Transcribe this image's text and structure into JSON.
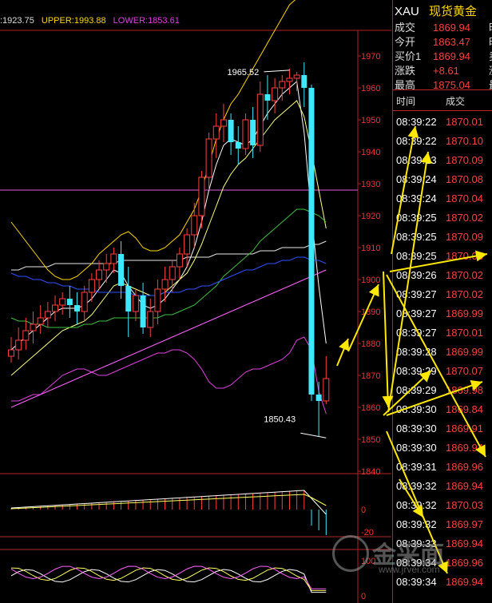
{
  "header": {
    "mid_label": ":1923.75",
    "upper_label": "UPPER:1993.88",
    "lower_label": "LOWER:1853.61"
  },
  "quote_panel": {
    "symbol": "XAU",
    "name": "现货黄金",
    "rows": [
      {
        "label": "成交",
        "value": "1869.94",
        "tail": "时"
      },
      {
        "label": "今开",
        "value": "1863.47",
        "tail": "时"
      },
      {
        "label": "买价1",
        "value": "1869.94",
        "tail": "卖"
      },
      {
        "label": "涨跌",
        "value": "+8.61",
        "tail": "涨"
      },
      {
        "label": "最高",
        "value": "1875.04",
        "tail": "最"
      }
    ],
    "col_time": "时间",
    "col_price": "成交",
    "ticks": [
      {
        "time": "08:39:22",
        "price": "1870.01"
      },
      {
        "time": "08:39:22",
        "price": "1870.10"
      },
      {
        "time": "08:39:23",
        "price": "1870.09"
      },
      {
        "time": "08:39:24",
        "price": "1870.08"
      },
      {
        "time": "08:39:24",
        "price": "1870.04"
      },
      {
        "time": "08:39:25",
        "price": "1870.02"
      },
      {
        "time": "08:39:25",
        "price": "1870.09"
      },
      {
        "time": "08:39:25",
        "price": "1870.03"
      },
      {
        "time": "08:39:26",
        "price": "1870.02"
      },
      {
        "time": "08:39:27",
        "price": "1870.02"
      },
      {
        "time": "08:39:27",
        "price": "1869.99"
      },
      {
        "time": "08:39:27",
        "price": "1870.01"
      },
      {
        "time": "08:39:28",
        "price": "1869.99"
      },
      {
        "time": "08:39:29",
        "price": "1870.07"
      },
      {
        "time": "08:39:29",
        "price": "1869.98"
      },
      {
        "time": "08:39:30",
        "price": "1869.84"
      },
      {
        "time": "08:39:30",
        "price": "1869.91"
      },
      {
        "time": "08:39:30",
        "price": "1869.94"
      },
      {
        "time": "08:39:31",
        "price": "1869.96"
      },
      {
        "time": "08:39:32",
        "price": "1869.94"
      },
      {
        "time": "08:39:32",
        "price": "1870.03"
      },
      {
        "time": "08:39:32",
        "price": "1869.97"
      },
      {
        "time": "08:39:33",
        "price": "1869.94"
      },
      {
        "time": "08:39:34",
        "price": "1869.96"
      },
      {
        "time": "08:39:34",
        "price": "1869.94"
      }
    ]
  },
  "watermark": {
    "cn": "金采面",
    "url": "www.jrvei.com"
  },
  "colors": {
    "up": "#ff4040",
    "down": "#40e8ff",
    "axis": "#b22222",
    "mid_band": "#e6e6e6",
    "upper_band": "#ffd700",
    "lower_band": "#e040e0",
    "arrow": "#ffe800"
  },
  "chart_data": {
    "type": "candlestick",
    "y_axis": {
      "min": 1840,
      "max": 1975,
      "ticks": [
        1840,
        1850,
        1860,
        1870,
        1880,
        1890,
        1900,
        1910,
        1920,
        1930,
        1940,
        1950,
        1960,
        1970
      ]
    },
    "annotations": [
      {
        "text": "1965.52",
        "value": 1965.52,
        "index": 38
      },
      {
        "text": "1850.43",
        "value": 1850.43,
        "index": 43
      }
    ],
    "candles": [
      {
        "o": 1876,
        "h": 1882,
        "c": 1878,
        "l": 1874
      },
      {
        "o": 1878,
        "h": 1885,
        "c": 1881,
        "l": 1875
      },
      {
        "o": 1881,
        "h": 1888,
        "c": 1884,
        "l": 1878
      },
      {
        "o": 1884,
        "h": 1890,
        "c": 1886,
        "l": 1880
      },
      {
        "o": 1886,
        "h": 1892,
        "c": 1888,
        "l": 1883
      },
      {
        "o": 1888,
        "h": 1893,
        "c": 1890,
        "l": 1885
      },
      {
        "o": 1890,
        "h": 1895,
        "c": 1892,
        "l": 1887
      },
      {
        "o": 1892,
        "h": 1896,
        "c": 1894,
        "l": 1889
      },
      {
        "o": 1894,
        "h": 1898,
        "c": 1892,
        "l": 1888
      },
      {
        "o": 1892,
        "h": 1896,
        "c": 1890,
        "l": 1886
      },
      {
        "o": 1890,
        "h": 1898,
        "c": 1896,
        "l": 1887
      },
      {
        "o": 1896,
        "h": 1902,
        "c": 1900,
        "l": 1893
      },
      {
        "o": 1900,
        "h": 1906,
        "c": 1903,
        "l": 1897
      },
      {
        "o": 1903,
        "h": 1908,
        "c": 1905,
        "l": 1899
      },
      {
        "o": 1905,
        "h": 1910,
        "c": 1908,
        "l": 1902
      },
      {
        "o": 1908,
        "h": 1912,
        "c": 1898,
        "l": 1894
      },
      {
        "o": 1898,
        "h": 1904,
        "c": 1890,
        "l": 1882
      },
      {
        "o": 1890,
        "h": 1897,
        "c": 1895,
        "l": 1887
      },
      {
        "o": 1895,
        "h": 1899,
        "c": 1885,
        "l": 1883
      },
      {
        "o": 1885,
        "h": 1894,
        "c": 1890,
        "l": 1882
      },
      {
        "o": 1890,
        "h": 1900,
        "c": 1897,
        "l": 1886
      },
      {
        "o": 1897,
        "h": 1904,
        "c": 1900,
        "l": 1893
      },
      {
        "o": 1900,
        "h": 1906,
        "c": 1904,
        "l": 1896
      },
      {
        "o": 1904,
        "h": 1910,
        "c": 1908,
        "l": 1900
      },
      {
        "o": 1908,
        "h": 1916,
        "c": 1914,
        "l": 1904
      },
      {
        "o": 1914,
        "h": 1924,
        "c": 1920,
        "l": 1910
      },
      {
        "o": 1920,
        "h": 1934,
        "c": 1932,
        "l": 1916
      },
      {
        "o": 1932,
        "h": 1946,
        "c": 1944,
        "l": 1928
      },
      {
        "o": 1944,
        "h": 1952,
        "c": 1948,
        "l": 1938
      },
      {
        "o": 1948,
        "h": 1955,
        "c": 1950,
        "l": 1943
      },
      {
        "o": 1950,
        "h": 1952,
        "c": 1943,
        "l": 1939
      },
      {
        "o": 1943,
        "h": 1948,
        "c": 1941,
        "l": 1936
      },
      {
        "o": 1941,
        "h": 1952,
        "c": 1950,
        "l": 1939
      },
      {
        "o": 1950,
        "h": 1954,
        "c": 1942,
        "l": 1938
      },
      {
        "o": 1942,
        "h": 1962,
        "c": 1958,
        "l": 1940
      },
      {
        "o": 1958,
        "h": 1964,
        "c": 1956,
        "l": 1950
      },
      {
        "o": 1956,
        "h": 1963,
        "c": 1960,
        "l": 1952
      },
      {
        "o": 1960,
        "h": 1964,
        "c": 1962,
        "l": 1956
      },
      {
        "o": 1962,
        "h": 1966,
        "c": 1963,
        "l": 1958
      },
      {
        "o": 1963,
        "h": 1965,
        "c": 1964,
        "l": 1959
      },
      {
        "o": 1964,
        "h": 1968,
        "c": 1960,
        "l": 1954
      },
      {
        "o": 1960,
        "h": 1961,
        "c": 1864,
        "l": 1862
      },
      {
        "o": 1864,
        "h": 1868,
        "c": 1862,
        "l": 1851
      },
      {
        "o": 1862,
        "h": 1876,
        "c": 1869,
        "l": 1861
      }
    ],
    "bands": {
      "mid": [
        1903,
        1903,
        1904,
        1904,
        1904,
        1904,
        1905,
        1905,
        1905,
        1905,
        1905,
        1905,
        1905,
        1905,
        1905,
        1906,
        1906,
        1906,
        1906,
        1906,
        1906,
        1906,
        1906,
        1906,
        1907,
        1907,
        1907,
        1907,
        1908,
        1908,
        1908,
        1908,
        1908,
        1908,
        1909,
        1909,
        1909,
        1910,
        1910,
        1910,
        1910,
        1911,
        1911,
        1912
      ],
      "upper": [
        1918,
        1915,
        1912,
        1909,
        1906,
        1903,
        1901,
        1900,
        1900,
        1901,
        1903,
        1905,
        1908,
        1910,
        1912,
        1914,
        1915,
        1913,
        1910,
        1909,
        1909,
        1910,
        1912,
        1914,
        1918,
        1922,
        1928,
        1936,
        1944,
        1950,
        1955,
        1958,
        1962,
        1966,
        1970,
        1974,
        1978,
        1982,
        1986,
        1988,
        1990,
        1990,
        1990,
        1990
      ],
      "lower": [
        1862,
        1862,
        1863,
        1864,
        1864,
        1866,
        1868,
        1870,
        1871,
        1872,
        1872,
        1871,
        1870,
        1870,
        1871,
        1872,
        1873,
        1874,
        1875,
        1876,
        1877,
        1877,
        1878,
        1878,
        1877,
        1875,
        1872,
        1868,
        1866,
        1866,
        1867,
        1869,
        1871,
        1872,
        1872,
        1873,
        1874,
        1875,
        1877,
        1881,
        1882,
        1878,
        1865,
        1858
      ]
    },
    "ma_lines": [
      {
        "color": "#ffffff",
        "values": [
          1878,
          1880,
          1882,
          1884,
          1886,
          1888,
          1890,
          1891,
          1891,
          1891,
          1892,
          1894,
          1897,
          1900,
          1903,
          1902,
          1898,
          1895,
          1892,
          1891,
          1892,
          1894,
          1897,
          1900,
          1904,
          1910,
          1918,
          1928,
          1936,
          1942,
          1944,
          1943,
          1942,
          1944,
          1948,
          1952,
          1955,
          1958,
          1960,
          1962,
          1946,
          1920,
          1898,
          1880
        ]
      },
      {
        "color": "#ffff80",
        "values": [
          1870,
          1872,
          1874,
          1876,
          1878,
          1880,
          1882,
          1884,
          1885,
          1886,
          1887,
          1889,
          1892,
          1895,
          1898,
          1899,
          1898,
          1897,
          1896,
          1895,
          1895,
          1896,
          1898,
          1900,
          1902,
          1906,
          1911,
          1917,
          1923,
          1929,
          1933,
          1936,
          1938,
          1941,
          1944,
          1947,
          1950,
          1952,
          1954,
          1956,
          1951,
          1940,
          1928,
          1916
        ]
      },
      {
        "color": "#40c040",
        "values": [
          1888,
          1887,
          1887,
          1886,
          1886,
          1885,
          1885,
          1885,
          1885,
          1885,
          1886,
          1886,
          1887,
          1887,
          1888,
          1888,
          1888,
          1888,
          1888,
          1888,
          1888,
          1889,
          1889,
          1890,
          1891,
          1892,
          1894,
          1896,
          1898,
          1901,
          1903,
          1905,
          1907,
          1909,
          1912,
          1914,
          1916,
          1918,
          1920,
          1922,
          1922,
          1921,
          1920,
          1918
        ]
      },
      {
        "color": "#3050ff",
        "values": [
          1902,
          1901,
          1901,
          1900,
          1900,
          1899,
          1899,
          1898,
          1898,
          1897,
          1897,
          1897,
          1896,
          1896,
          1896,
          1896,
          1896,
          1895,
          1895,
          1895,
          1895,
          1896,
          1896,
          1896,
          1897,
          1897,
          1898,
          1898,
          1899,
          1900,
          1901,
          1902,
          1903,
          1903,
          1904,
          1905,
          1905,
          1906,
          1906,
          1907,
          1907,
          1906,
          1906,
          1905
        ]
      },
      {
        "color": "#ff60ff",
        "values": [
          1860,
          1861,
          1862,
          1863,
          1864,
          1865,
          1866,
          1867,
          1868,
          1869,
          1870,
          1871,
          1872,
          1873,
          1874,
          1875,
          1876,
          1877,
          1878,
          1879,
          1880,
          1881,
          1882,
          1883,
          1884,
          1885,
          1886,
          1887,
          1888,
          1889,
          1890,
          1891,
          1892,
          1893,
          1894,
          1895,
          1896,
          1897,
          1898,
          1899,
          1900,
          1901,
          1902,
          1903
        ]
      }
    ],
    "horizontal_line": {
      "value": 1928,
      "color": "#e060e0"
    },
    "macd_panel": {
      "ticks": [
        0,
        -20
      ]
    },
    "kdj_panel": {
      "ticks": [
        100,
        0
      ]
    }
  }
}
